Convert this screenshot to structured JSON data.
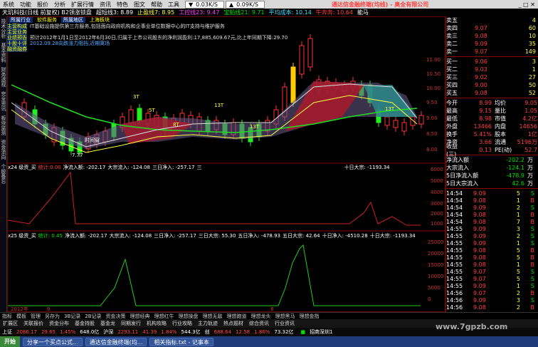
{
  "menu": [
    "系统",
    "功能",
    "报价",
    "分析",
    "扩展行情",
    "资讯",
    "特色",
    "图文",
    "帮助",
    "工具"
  ],
  "menu_extra": {
    "net1": "0.03K/S",
    "net2": "0.09K/S",
    "app_title": "通达信金融终端(均线) - 奥全有限公司"
  },
  "topbar": {
    "stock": "天玑科技(日线 前复权) B2领涨锁盘",
    "osc": "超短线3: 8.89",
    "ind1": "止盈线7: 8.95",
    "ind2": "工控线23: 9.47",
    "ind3": "宝船线21: 9.71",
    "ind4": "平均成本: 10.14",
    "ind5": "牛奔奔: 10.64",
    "ind6": "能马"
  },
  "infobox": {
    "tags": [
      "所属行业",
      "软件服务",
      "所属地区",
      "上海板块"
    ],
    "labels": [
      "主营构成",
      "主营业务",
      "业绩预告",
      "十股十评",
      "融资融券"
    ],
    "line1": "IT基础设施提供第三方服务,包括面向政府机构和企事业单位数据中心的IT支持与维护服务",
    "line2": "预计2012年1月1日至2012年6月30日,归属于上市公司股东的净利润盈利:17,885,609.67元,比上年同期下降:29.70",
    "line3": "2012.09.28向跌涨力阻挡,近期寓场"
  },
  "chart_labels": {
    "l1": "3T",
    "l2": "5T",
    "l3": "13T",
    "l4": "8T",
    "l5": "13T",
    "l6": "13T",
    "lead": "时间窗",
    "low": "7.77"
  },
  "sub1": {
    "name": "x24 级资_买",
    "v1": "统计:0.00",
    "v2": "净流入额: -202.17",
    "v3": "大宗流入: -124.08",
    "v4": "三日净入: -257.17",
    "v5": "三",
    "v6": "十日大宗: -1193.34"
  },
  "sub2": {
    "name": "x25 级资_买",
    "v1": "统计: 0.45",
    "v2": "净流入额: -202.17",
    "v3": "大宗流入: -124.08",
    "v4": "三日净入: -257.17",
    "v5": "三日大宗: 55.30",
    "v6": "五日净入: -478.93",
    "v7": "五日大宗: 42.64",
    "v8": "十日净入: -4510.28",
    "v9": "十日大宗: -1193.34"
  },
  "price_axis": [
    "11.00",
    "10.50",
    "10.00",
    "9.50",
    "9.00",
    "8.50",
    "8.00"
  ],
  "sub1_axis": [
    "6000",
    "5000",
    "4000",
    "3000",
    "2000",
    "1000"
  ],
  "sub2_axis": [
    "25000",
    "20000",
    "15000",
    "10000",
    "5000",
    "0"
  ],
  "date_axis": [
    "2012年",
    "9",
    "8",
    "9"
  ],
  "orderbook": {
    "sells": [
      {
        "k": "五",
        "p": "",
        "v": "4"
      },
      {
        "k": "四",
        "p": "9.07",
        "v": "60"
      },
      {
        "k": "三",
        "p": "9.08",
        "v": "10"
      },
      {
        "k": "二",
        "p": "9.09",
        "v": "35"
      },
      {
        "k": "一",
        "p": "9.07",
        "v": "149"
      }
    ],
    "buys": [
      {
        "k": "一",
        "p": "9.06",
        "v": "3"
      },
      {
        "k": "二",
        "p": "9.03",
        "v": "1"
      },
      {
        "k": "三",
        "p": "9.02",
        "v": "27"
      },
      {
        "k": "四",
        "p": "9.00",
        "v": "50"
      },
      {
        "k": "五",
        "p": "9.08",
        "v": "52"
      }
    ]
  },
  "stats": [
    {
      "a": "今开",
      "b": "8.99",
      "c": "均价",
      "d": "9.05"
    },
    {
      "a": "最高",
      "b": "9.15",
      "c": "量比",
      "d": "1.05"
    },
    {
      "a": "最低",
      "b": "8.98",
      "c": "市值",
      "d": "4.2亿"
    },
    {
      "a": "外盘",
      "b": "13466",
      "c": "内盘",
      "d": "14656"
    },
    {
      "a": "换手",
      "b": "5.41%",
      "c": "股本",
      "d": "1亿"
    },
    {
      "a": "净资",
      "b": "3.66",
      "c": "流通",
      "d": "5196万"
    },
    {
      "a": "收益(三)",
      "b": "0.13",
      "c": "PE(动)",
      "d": "52.7"
    }
  ],
  "flows": [
    {
      "a": "净流入额",
      "b": "-202.2",
      "c": "万"
    },
    {
      "a": "大宗流入",
      "b": "-124.1",
      "c": "万"
    },
    {
      "a": "5日净流入额",
      "b": "-478.9",
      "c": "万"
    },
    {
      "a": "5日大宗流入",
      "b": "42.6",
      "c": "万"
    }
  ],
  "ticks": [
    {
      "t": "14:54",
      "p": "9.09",
      "v": "5",
      "s": "S"
    },
    {
      "t": "14:54",
      "p": "9.08",
      "v": "1",
      "s": "B"
    },
    {
      "t": "14:54",
      "p": "9.09",
      "v": "2",
      "s": "S"
    },
    {
      "t": "14:54",
      "p": "9.08",
      "v": "1",
      "s": "B"
    },
    {
      "t": "14:54",
      "p": "9.08",
      "v": "7",
      "s": "B"
    },
    {
      "t": "14:55",
      "p": "9.09",
      "v": "3",
      "s": "S"
    },
    {
      "t": "14:55",
      "p": "9.09",
      "v": "2",
      "s": "S"
    },
    {
      "t": "14:55",
      "p": "9.09",
      "v": "1",
      "s": "S"
    },
    {
      "t": "14:55",
      "p": "9.08",
      "v": "5",
      "s": "B"
    },
    {
      "t": "14:55",
      "p": "9.08",
      "v": "5",
      "s": "B"
    },
    {
      "t": "14:55",
      "p": "9.08",
      "v": "1",
      "s": "B"
    },
    {
      "t": "14:55",
      "p": "9.07",
      "v": "5",
      "s": "S"
    },
    {
      "t": "14:55",
      "p": "9.07",
      "v": "5",
      "s": "S"
    },
    {
      "t": "14:55",
      "p": "9.09",
      "v": "1",
      "s": "S"
    },
    {
      "t": "14:56",
      "p": "9.07",
      "v": "2",
      "s": "B"
    },
    {
      "t": "14:56",
      "p": "9.09",
      "v": "3",
      "s": "S"
    },
    {
      "t": "14:56",
      "p": "9.08",
      "v": "2",
      "s": "B"
    },
    {
      "t": "14:59",
      "p": "9.09",
      "v": "1",
      "s": "S"
    },
    {
      "t": "14:59",
      "p": "9.08",
      "v": "5",
      "s": "B"
    },
    {
      "t": "15:00",
      "p": "9.09",
      "v": "5",
      "s": "S"
    }
  ],
  "tabs1": [
    "指标",
    "模板",
    "管理",
    "另存为",
    "3B记录",
    "2B记录",
    "资金决策",
    "理想经典",
    "理想红牛",
    "理想操盘",
    "理想无敌",
    "理想跑道",
    "理想龙头",
    "理想黑马",
    "理想金指"
  ],
  "tabs2": [
    "扩展区",
    "关联报价",
    "资金分布",
    "基金持股",
    "基金龙",
    "同期发行",
    "机构攻略",
    "行业攻略",
    "主力轨迹",
    "热点题材",
    "综合资讯",
    "行业资讯"
  ],
  "status": {
    "sh": "上证",
    "sh_v": "2086.17",
    "sh_c": "29.65",
    "sh_p": "1.45%",
    "sh_amt": "648.0亿",
    "sz": "沪深",
    "sz_v": "2293.11",
    "sz_c": "41.39",
    "sz_p": "1.84%",
    "sz_amt": "544.3亿",
    "cy": "创",
    "cy_v": "688.64",
    "cy_c": "12.58",
    "cy_p": "1.86%",
    "cy_amt": "73.32亿",
    "msg": "招商深圳1"
  },
  "taskbar": {
    "start": "开始",
    "t1": "分享一个买点公式...",
    "t2": "通达信金融终端(均...",
    "t3": "相关指标.txt - 记事本"
  },
  "watermark": "www.7gpzb.com"
}
